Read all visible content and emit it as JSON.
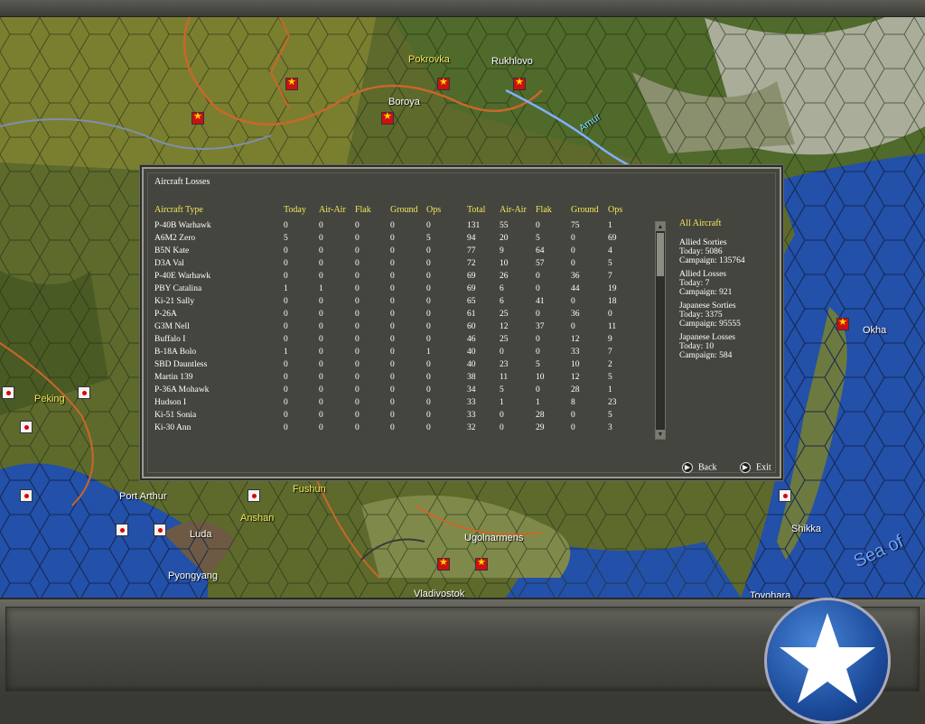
{
  "map": {
    "labels": [
      {
        "text": "Pokrovka",
        "cls": "yel"
      },
      {
        "text": "Rukhlovo",
        "cls": ""
      },
      {
        "text": "Boroya",
        "cls": ""
      },
      {
        "text": "Amur",
        "cls": ""
      },
      {
        "text": "Okha",
        "cls": ""
      },
      {
        "text": "Peking",
        "cls": "yel"
      },
      {
        "text": "Port Arthur",
        "cls": ""
      },
      {
        "text": "Luda",
        "cls": ""
      },
      {
        "text": "Anshan",
        "cls": "yel"
      },
      {
        "text": "Fushun",
        "cls": "yel"
      },
      {
        "text": "Pyongyang",
        "cls": ""
      },
      {
        "text": "Vladivostok",
        "cls": ""
      },
      {
        "text": "Ugolnarmens",
        "cls": ""
      },
      {
        "text": "Shikka",
        "cls": ""
      },
      {
        "text": "Toyohara",
        "cls": ""
      },
      {
        "text": "Sea of",
        "cls": ""
      }
    ]
  },
  "dialog": {
    "title": "Aircraft Losses",
    "headers": [
      "Aircraft Type",
      "Today",
      "Air-Air",
      "Flak",
      "Ground",
      "Ops",
      "Total",
      "Air-Air",
      "Flak",
      "Ground",
      "Ops"
    ],
    "rows": [
      [
        "P-40B Warhawk",
        "0",
        "0",
        "0",
        "0",
        "0",
        "131",
        "55",
        "0",
        "75",
        "1"
      ],
      [
        "A6M2 Zero",
        "5",
        "0",
        "0",
        "0",
        "5",
        "94",
        "20",
        "5",
        "0",
        "69"
      ],
      [
        "B5N Kate",
        "0",
        "0",
        "0",
        "0",
        "0",
        "77",
        "9",
        "64",
        "0",
        "4"
      ],
      [
        "D3A Val",
        "0",
        "0",
        "0",
        "0",
        "0",
        "72",
        "10",
        "57",
        "0",
        "5"
      ],
      [
        "P-40E Warhawk",
        "0",
        "0",
        "0",
        "0",
        "0",
        "69",
        "26",
        "0",
        "36",
        "7"
      ],
      [
        "PBY Catalina",
        "1",
        "1",
        "0",
        "0",
        "0",
        "69",
        "6",
        "0",
        "44",
        "19"
      ],
      [
        "Ki-21 Sally",
        "0",
        "0",
        "0",
        "0",
        "0",
        "65",
        "6",
        "41",
        "0",
        "18"
      ],
      [
        "P-26A",
        "0",
        "0",
        "0",
        "0",
        "0",
        "61",
        "25",
        "0",
        "36",
        "0"
      ],
      [
        "G3M Nell",
        "0",
        "0",
        "0",
        "0",
        "0",
        "60",
        "12",
        "37",
        "0",
        "11"
      ],
      [
        "Buffalo I",
        "0",
        "0",
        "0",
        "0",
        "0",
        "46",
        "25",
        "0",
        "12",
        "9"
      ],
      [
        "B-18A Bolo",
        "1",
        "0",
        "0",
        "0",
        "1",
        "40",
        "0",
        "0",
        "33",
        "7"
      ],
      [
        "SBD Dauntless",
        "0",
        "0",
        "0",
        "0",
        "0",
        "40",
        "23",
        "5",
        "10",
        "2"
      ],
      [
        "Martin 139",
        "0",
        "0",
        "0",
        "0",
        "0",
        "38",
        "11",
        "10",
        "12",
        "5"
      ],
      [
        "P-36A Mohawk",
        "0",
        "0",
        "0",
        "0",
        "0",
        "34",
        "5",
        "0",
        "28",
        "1"
      ],
      [
        "Hudson I",
        "0",
        "0",
        "0",
        "0",
        "0",
        "33",
        "1",
        "1",
        "8",
        "23"
      ],
      [
        "Ki-51 Sonia",
        "0",
        "0",
        "0",
        "0",
        "0",
        "33",
        "0",
        "28",
        "0",
        "5"
      ],
      [
        "Ki-30 Ann",
        "0",
        "0",
        "0",
        "0",
        "0",
        "32",
        "0",
        "29",
        "0",
        "3"
      ]
    ],
    "side": {
      "heading": "All Aircraft",
      "blocks": [
        {
          "title": "Allied Sorties",
          "today": "Today:   5086",
          "campaign": "Campaign: 135764"
        },
        {
          "title": "Allied Losses",
          "today": "Today:   7",
          "campaign": "Campaign: 921"
        },
        {
          "title": "Japanese Sorties",
          "today": "Today:   3375",
          "campaign": "Campaign: 95555"
        },
        {
          "title": "Japanese Losses",
          "today": "Today:   10",
          "campaign": "Campaign: 584"
        }
      ]
    },
    "buttons": {
      "back": "Back",
      "exit": "Exit"
    }
  },
  "colors": {
    "header": "#f2e85a",
    "panel": "#45453f",
    "allied_star_bg": "#1d4c9c"
  }
}
